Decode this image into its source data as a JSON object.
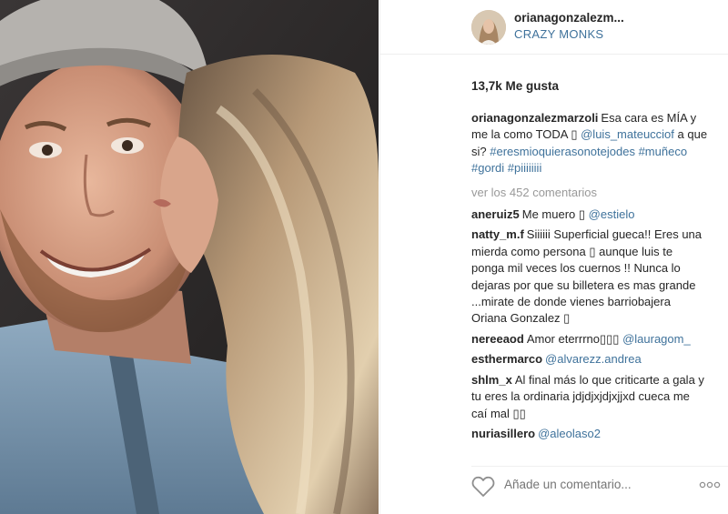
{
  "post": {
    "photo_icon": "selfie-photo"
  },
  "header": {
    "username": "orianagonzalezm...",
    "location": "CRAZY MONKS"
  },
  "likes": "13,7k Me gusta",
  "caption": {
    "user": "orianagonzalezmarzoli",
    "text1": "Esa cara es MÍA y me la como TODA ▯ ",
    "mention": "@luis_mateucciof",
    "text2": " a que si? ",
    "hashtag1": "#eresmioquierasonotejodes",
    "hashtag2": "#muñeco",
    "hashtag3": "#gordi",
    "hashtag4": "#piiiiiiii"
  },
  "more_comments": "ver los 452 comentarios",
  "comments": [
    {
      "user": "aneruiz5",
      "text": "Me muero ▯ ",
      "mention": "@estielo"
    },
    {
      "user": "natty_m.f",
      "text": "Siiiiii Superficial gueca!! Eres una mierda como persona ▯ aunque luis te ponga mil veces los cuernos !! Nunca lo dejaras por que su billetera es mas grande ...mirate de donde vienes barriobajera Oriana Gonzalez ▯",
      "mention": ""
    },
    {
      "user": "nereeaod",
      "text": "Amor eterrrno▯▯▯ ",
      "mention": "@lauragom_"
    },
    {
      "user": "esthermarco",
      "text": "",
      "mention": "@alvarezz.andrea"
    },
    {
      "user": "shlm_x",
      "text": "Al final más lo que criticarte a gala y tu eres la ordinaria jdjdjxjdjxjjxd cueca me caí mal ▯▯",
      "mention": ""
    },
    {
      "user": "nuriasillero",
      "text": "",
      "mention": "@aleolaso2"
    }
  ],
  "footer": {
    "placeholder": "Añade un comentario...",
    "heart_icon": "heart-icon",
    "more_icon": "more-options-icon"
  }
}
